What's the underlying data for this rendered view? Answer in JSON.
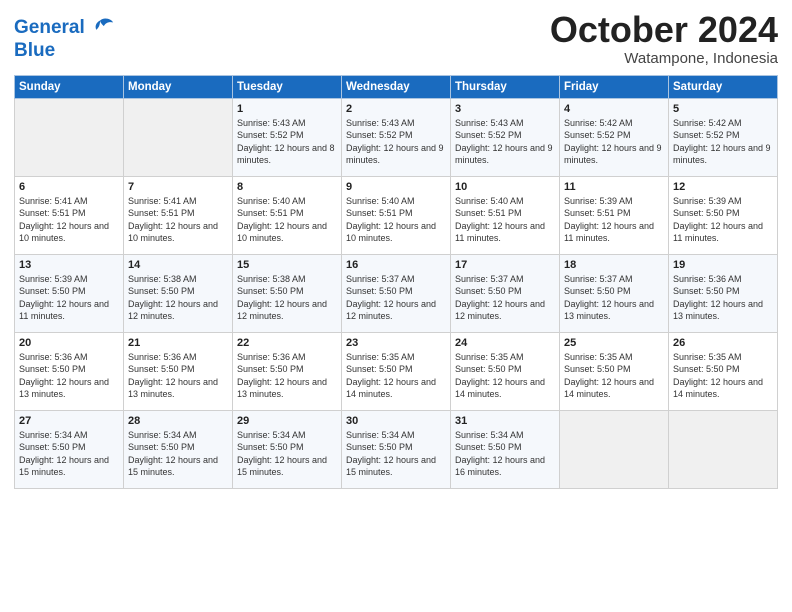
{
  "header": {
    "logo_line1": "General",
    "logo_line2": "Blue",
    "month": "October 2024",
    "location": "Watampone, Indonesia"
  },
  "weekdays": [
    "Sunday",
    "Monday",
    "Tuesday",
    "Wednesday",
    "Thursday",
    "Friday",
    "Saturday"
  ],
  "weeks": [
    [
      {
        "day": "",
        "sunrise": "",
        "sunset": "",
        "daylight": ""
      },
      {
        "day": "",
        "sunrise": "",
        "sunset": "",
        "daylight": ""
      },
      {
        "day": "1",
        "sunrise": "Sunrise: 5:43 AM",
        "sunset": "Sunset: 5:52 PM",
        "daylight": "Daylight: 12 hours and 8 minutes."
      },
      {
        "day": "2",
        "sunrise": "Sunrise: 5:43 AM",
        "sunset": "Sunset: 5:52 PM",
        "daylight": "Daylight: 12 hours and 9 minutes."
      },
      {
        "day": "3",
        "sunrise": "Sunrise: 5:43 AM",
        "sunset": "Sunset: 5:52 PM",
        "daylight": "Daylight: 12 hours and 9 minutes."
      },
      {
        "day": "4",
        "sunrise": "Sunrise: 5:42 AM",
        "sunset": "Sunset: 5:52 PM",
        "daylight": "Daylight: 12 hours and 9 minutes."
      },
      {
        "day": "5",
        "sunrise": "Sunrise: 5:42 AM",
        "sunset": "Sunset: 5:52 PM",
        "daylight": "Daylight: 12 hours and 9 minutes."
      }
    ],
    [
      {
        "day": "6",
        "sunrise": "Sunrise: 5:41 AM",
        "sunset": "Sunset: 5:51 PM",
        "daylight": "Daylight: 12 hours and 10 minutes."
      },
      {
        "day": "7",
        "sunrise": "Sunrise: 5:41 AM",
        "sunset": "Sunset: 5:51 PM",
        "daylight": "Daylight: 12 hours and 10 minutes."
      },
      {
        "day": "8",
        "sunrise": "Sunrise: 5:40 AM",
        "sunset": "Sunset: 5:51 PM",
        "daylight": "Daylight: 12 hours and 10 minutes."
      },
      {
        "day": "9",
        "sunrise": "Sunrise: 5:40 AM",
        "sunset": "Sunset: 5:51 PM",
        "daylight": "Daylight: 12 hours and 10 minutes."
      },
      {
        "day": "10",
        "sunrise": "Sunrise: 5:40 AM",
        "sunset": "Sunset: 5:51 PM",
        "daylight": "Daylight: 12 hours and 11 minutes."
      },
      {
        "day": "11",
        "sunrise": "Sunrise: 5:39 AM",
        "sunset": "Sunset: 5:51 PM",
        "daylight": "Daylight: 12 hours and 11 minutes."
      },
      {
        "day": "12",
        "sunrise": "Sunrise: 5:39 AM",
        "sunset": "Sunset: 5:50 PM",
        "daylight": "Daylight: 12 hours and 11 minutes."
      }
    ],
    [
      {
        "day": "13",
        "sunrise": "Sunrise: 5:39 AM",
        "sunset": "Sunset: 5:50 PM",
        "daylight": "Daylight: 12 hours and 11 minutes."
      },
      {
        "day": "14",
        "sunrise": "Sunrise: 5:38 AM",
        "sunset": "Sunset: 5:50 PM",
        "daylight": "Daylight: 12 hours and 12 minutes."
      },
      {
        "day": "15",
        "sunrise": "Sunrise: 5:38 AM",
        "sunset": "Sunset: 5:50 PM",
        "daylight": "Daylight: 12 hours and 12 minutes."
      },
      {
        "day": "16",
        "sunrise": "Sunrise: 5:37 AM",
        "sunset": "Sunset: 5:50 PM",
        "daylight": "Daylight: 12 hours and 12 minutes."
      },
      {
        "day": "17",
        "sunrise": "Sunrise: 5:37 AM",
        "sunset": "Sunset: 5:50 PM",
        "daylight": "Daylight: 12 hours and 12 minutes."
      },
      {
        "day": "18",
        "sunrise": "Sunrise: 5:37 AM",
        "sunset": "Sunset: 5:50 PM",
        "daylight": "Daylight: 12 hours and 13 minutes."
      },
      {
        "day": "19",
        "sunrise": "Sunrise: 5:36 AM",
        "sunset": "Sunset: 5:50 PM",
        "daylight": "Daylight: 12 hours and 13 minutes."
      }
    ],
    [
      {
        "day": "20",
        "sunrise": "Sunrise: 5:36 AM",
        "sunset": "Sunset: 5:50 PM",
        "daylight": "Daylight: 12 hours and 13 minutes."
      },
      {
        "day": "21",
        "sunrise": "Sunrise: 5:36 AM",
        "sunset": "Sunset: 5:50 PM",
        "daylight": "Daylight: 12 hours and 13 minutes."
      },
      {
        "day": "22",
        "sunrise": "Sunrise: 5:36 AM",
        "sunset": "Sunset: 5:50 PM",
        "daylight": "Daylight: 12 hours and 13 minutes."
      },
      {
        "day": "23",
        "sunrise": "Sunrise: 5:35 AM",
        "sunset": "Sunset: 5:50 PM",
        "daylight": "Daylight: 12 hours and 14 minutes."
      },
      {
        "day": "24",
        "sunrise": "Sunrise: 5:35 AM",
        "sunset": "Sunset: 5:50 PM",
        "daylight": "Daylight: 12 hours and 14 minutes."
      },
      {
        "day": "25",
        "sunrise": "Sunrise: 5:35 AM",
        "sunset": "Sunset: 5:50 PM",
        "daylight": "Daylight: 12 hours and 14 minutes."
      },
      {
        "day": "26",
        "sunrise": "Sunrise: 5:35 AM",
        "sunset": "Sunset: 5:50 PM",
        "daylight": "Daylight: 12 hours and 14 minutes."
      }
    ],
    [
      {
        "day": "27",
        "sunrise": "Sunrise: 5:34 AM",
        "sunset": "Sunset: 5:50 PM",
        "daylight": "Daylight: 12 hours and 15 minutes."
      },
      {
        "day": "28",
        "sunrise": "Sunrise: 5:34 AM",
        "sunset": "Sunset: 5:50 PM",
        "daylight": "Daylight: 12 hours and 15 minutes."
      },
      {
        "day": "29",
        "sunrise": "Sunrise: 5:34 AM",
        "sunset": "Sunset: 5:50 PM",
        "daylight": "Daylight: 12 hours and 15 minutes."
      },
      {
        "day": "30",
        "sunrise": "Sunrise: 5:34 AM",
        "sunset": "Sunset: 5:50 PM",
        "daylight": "Daylight: 12 hours and 15 minutes."
      },
      {
        "day": "31",
        "sunrise": "Sunrise: 5:34 AM",
        "sunset": "Sunset: 5:50 PM",
        "daylight": "Daylight: 12 hours and 16 minutes."
      },
      {
        "day": "",
        "sunrise": "",
        "sunset": "",
        "daylight": ""
      },
      {
        "day": "",
        "sunrise": "",
        "sunset": "",
        "daylight": ""
      }
    ]
  ]
}
